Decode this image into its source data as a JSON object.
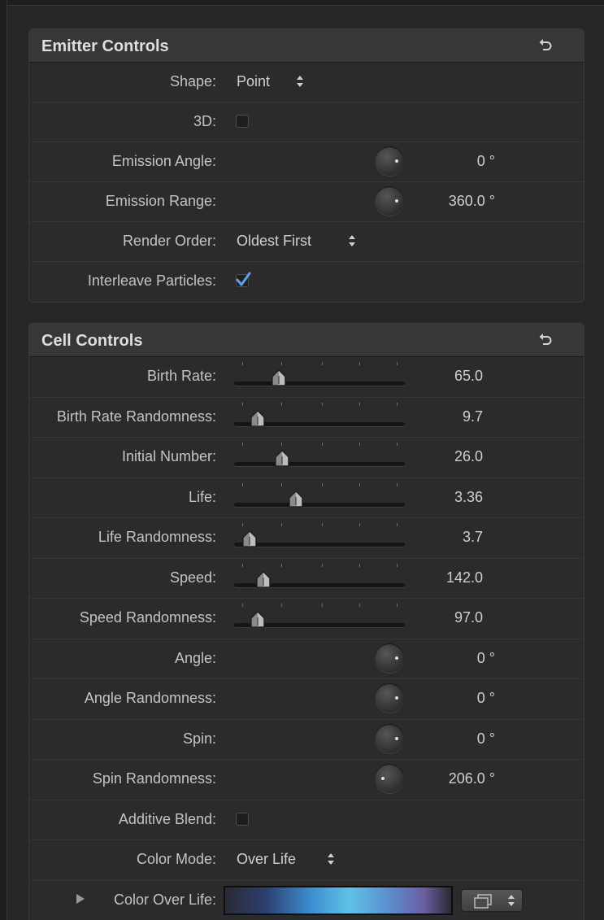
{
  "emitter": {
    "title": "Emitter Controls",
    "shape": {
      "label": "Shape:",
      "value": "Point"
    },
    "three_d": {
      "label": "3D:",
      "checked": false
    },
    "emission_angle": {
      "label": "Emission Angle:",
      "value": "0 °"
    },
    "emission_range": {
      "label": "Emission Range:",
      "value": "360.0 °"
    },
    "render_order": {
      "label": "Render Order:",
      "value": "Oldest First"
    },
    "interleave": {
      "label": "Interleave Particles:",
      "checked": true
    }
  },
  "cell": {
    "title": "Cell Controls",
    "sliders": [
      {
        "label": "Birth Rate:",
        "value": "65.0",
        "level": 0.26
      },
      {
        "label": "Birth Rate Randomness:",
        "value": "9.7",
        "level": 0.14
      },
      {
        "label": "Initial Number:",
        "value": "26.0",
        "level": 0.28
      },
      {
        "label": "Life:",
        "value": "3.36",
        "level": 0.36
      },
      {
        "label": "Life Randomness:",
        "value": "3.7",
        "level": 0.09
      },
      {
        "label": "Speed:",
        "value": "142.0",
        "level": 0.17
      },
      {
        "label": "Speed Randomness:",
        "value": "97.0",
        "level": 0.14
      }
    ],
    "angle": {
      "label": "Angle:",
      "value": "0 °"
    },
    "angle_randomness": {
      "label": "Angle Randomness:",
      "value": "0 °"
    },
    "spin": {
      "label": "Spin:",
      "value": "0 °"
    },
    "spin_randomness": {
      "label": "Spin Randomness:",
      "value": "206.0 °"
    },
    "additive_blend": {
      "label": "Additive Blend:",
      "checked": false
    },
    "color_mode": {
      "label": "Color Mode:",
      "value": "Over Life"
    },
    "color_over_life": {
      "label": "Color Over Life:"
    }
  },
  "icons": {
    "reset": "reset-arrow-icon",
    "popup": "up-down-arrows-icon",
    "check": "checkmark-icon",
    "disclosure": "disclosure-triangle-icon",
    "preset": "gradient-preset-icon"
  },
  "colors": {
    "background": "#262626",
    "header": "#373737",
    "accent_check": "#5aa2ea"
  }
}
